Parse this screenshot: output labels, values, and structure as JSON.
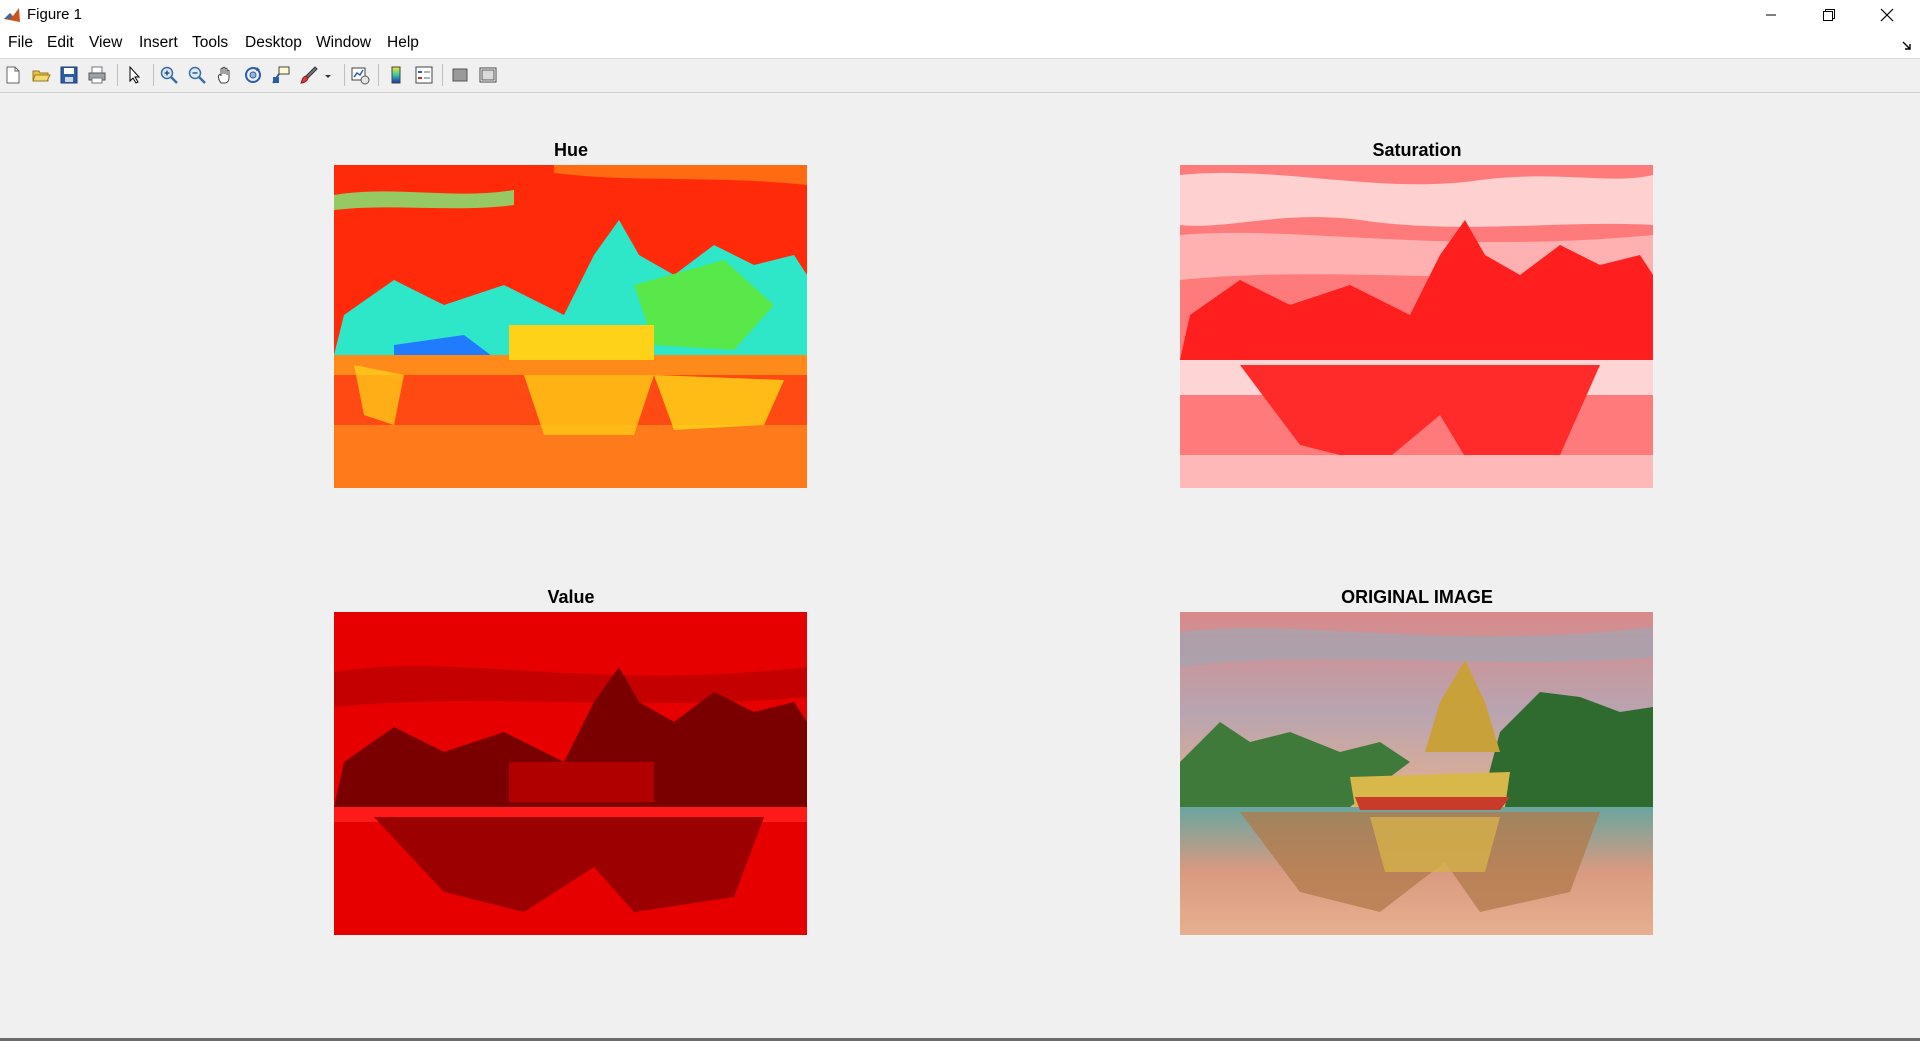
{
  "window": {
    "title": "Figure 1",
    "icon": "matlab-icon",
    "controls": [
      "minimize-icon",
      "restore-icon",
      "close-icon"
    ]
  },
  "menu": {
    "items": [
      {
        "label": "File"
      },
      {
        "label": "Edit"
      },
      {
        "label": "View"
      },
      {
        "label": "Insert"
      },
      {
        "label": "Tools"
      },
      {
        "label": "Desktop"
      },
      {
        "label": "Window"
      },
      {
        "label": "Help"
      }
    ]
  },
  "toolbar": {
    "icons": [
      "new-figure-icon",
      "open-file-icon",
      "save-icon",
      "print-icon",
      "edit-plot-icon",
      "zoom-in-icon",
      "zoom-out-icon",
      "pan-icon",
      "rotate-3d-icon",
      "data-cursor-icon",
      "brush-icon",
      "link-plot-icon",
      "colorbar-icon",
      "legend-icon",
      "hide-plot-tools-icon",
      "show-plot-tools-icon"
    ]
  },
  "figure": {
    "axes": [
      {
        "title": "Hue",
        "image": "hue-channel-image"
      },
      {
        "title": "Saturation",
        "image": "saturation-channel-image"
      },
      {
        "title": "Value",
        "image": "value-channel-image"
      },
      {
        "title": "ORIGINAL IMAGE",
        "image": "original-image"
      }
    ]
  },
  "colors": {
    "hue_base": "#ff3b0a",
    "saturation_base": "#ff1a1a",
    "value_base": "#e00000",
    "figure_bg": "#f0f0f0"
  }
}
